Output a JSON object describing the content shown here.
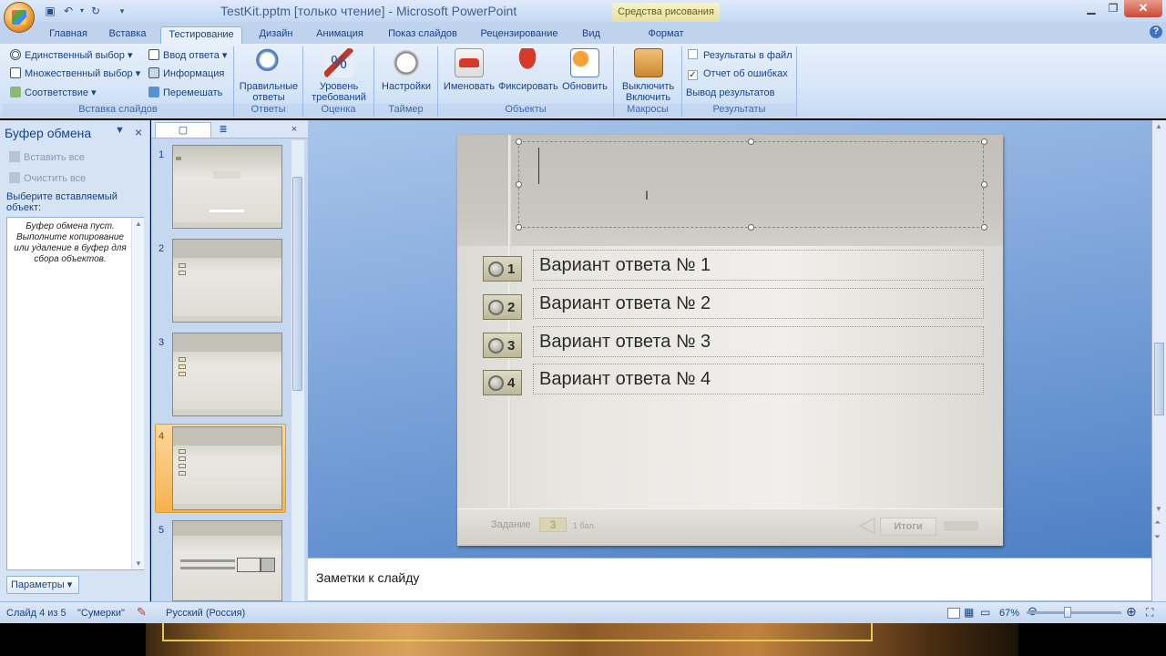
{
  "window": {
    "title": "TestKit.pptm [только чтение] - Microsoft PowerPoint",
    "context_tab_group": "Средства рисования"
  },
  "tabs": [
    "Главная",
    "Вставка",
    "Тестирование",
    "Дизайн",
    "Анимация",
    "Показ слайдов",
    "Рецензирование",
    "Вид",
    "Формат"
  ],
  "active_tab": "Тестирование",
  "ribbon": {
    "insert_slides": {
      "label": "Вставка слайдов",
      "single_choice": "Единственный выбор",
      "multiple_choice": "Множественный выбор",
      "matching": "Соответствие",
      "answer_input": "Ввод ответа",
      "information": "Информация",
      "shuffle": "Перемешать"
    },
    "answers": {
      "label": "Ответы",
      "correct_answers": "Правильные ответы"
    },
    "grading": {
      "label": "Оценка",
      "requirement_level": "Уровень требований"
    },
    "timer": {
      "label": "Таймер",
      "settings": "Настройки"
    },
    "objects": {
      "label": "Объекты",
      "rename": "Именовать",
      "fix": "Фиксировать",
      "update": "Обновить"
    },
    "macros": {
      "label": "Макросы",
      "toggle": "Выключить Включить"
    },
    "results": {
      "label": "Результаты",
      "results_to_file": "Результаты в файл",
      "results_to_file_checked": false,
      "error_report": "Отчет об ошибках",
      "error_report_checked": true,
      "output_results": "Вывод результатов"
    }
  },
  "clipboard": {
    "title": "Буфер обмена",
    "paste_all": "Вставить все",
    "clear_all": "Очистить все",
    "prompt": "Выберите вставляемый объект:",
    "empty_message": "Буфер обмена пуст. Выполните копирование или удаление в буфер для сбора объектов.",
    "params": "Параметры"
  },
  "slides": {
    "numbers": [
      "1",
      "2",
      "3",
      "4",
      "5"
    ],
    "selected": "4"
  },
  "slide": {
    "options": [
      {
        "num": "1",
        "text": "Вариант ответа № 1"
      },
      {
        "num": "2",
        "text": "Вариант ответа № 2"
      },
      {
        "num": "3",
        "text": "Вариант ответа № 3"
      },
      {
        "num": "4",
        "text": "Вариант ответа № 4"
      }
    ],
    "footer": {
      "task_label": "Задание",
      "task_number": "3",
      "points": "1 бал.",
      "results_button": "Итоги"
    }
  },
  "notes": {
    "placeholder": "Заметки к слайду"
  },
  "status": {
    "slide_info": "Слайд 4 из 5",
    "theme": "\"Сумерки\"",
    "language": "Русский (Россия)",
    "zoom": "67%"
  },
  "colors": {
    "accent": "#15428b",
    "ribbon_bg": "#d3e3f7",
    "selected_slide": "#f5b24f",
    "close_button": "#c74a35"
  }
}
